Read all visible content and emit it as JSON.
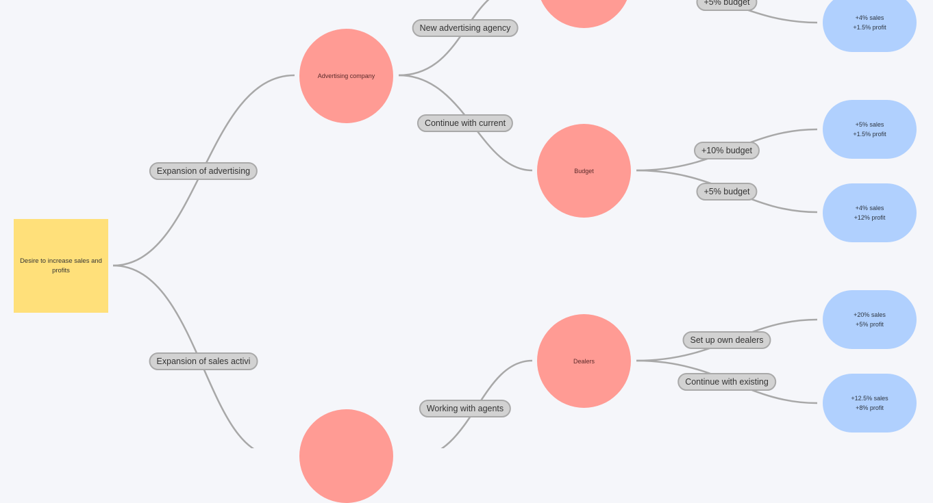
{
  "diagram": {
    "type": "decision-tree",
    "colors": {
      "background": "#f5f6fa",
      "root": "#ffe07a",
      "decision": "#ff9b94",
      "outcome": "#b0d0fe",
      "label": "#d2d2d2",
      "connector": "#a8a8a8"
    },
    "root": {
      "text": "Desire to increase sales and profits"
    },
    "branch_labels": {
      "expansion_advertising": "Expansion of advertising",
      "expansion_sales": "Expansion of sales activi",
      "new_agency": "New advertising agency",
      "continue_current": "Continue with current",
      "budget_top_5": "+5% budget",
      "budget_10": "+10% budget",
      "budget_5": "+5% budget",
      "working_agents": "Working with agents",
      "own_dealers": "Set up own dealers",
      "continue_existing": "Continue with existing"
    },
    "decisions": {
      "advertising_company": "Advertising company",
      "budget": "Budget",
      "dealers": "Dealers",
      "top_partial": "",
      "bottom_partial": ""
    },
    "outcomes": [
      {
        "sales": "+4% sales",
        "profit": "+1.5% profit"
      },
      {
        "sales": "+5% sales",
        "profit": "+1.5% profit"
      },
      {
        "sales": "+4% sales",
        "profit": "+12% profit"
      },
      {
        "sales": "+20% sales",
        "profit": "+5% profit"
      },
      {
        "sales": "+12.5% sales",
        "profit": "+8% profit"
      }
    ]
  }
}
